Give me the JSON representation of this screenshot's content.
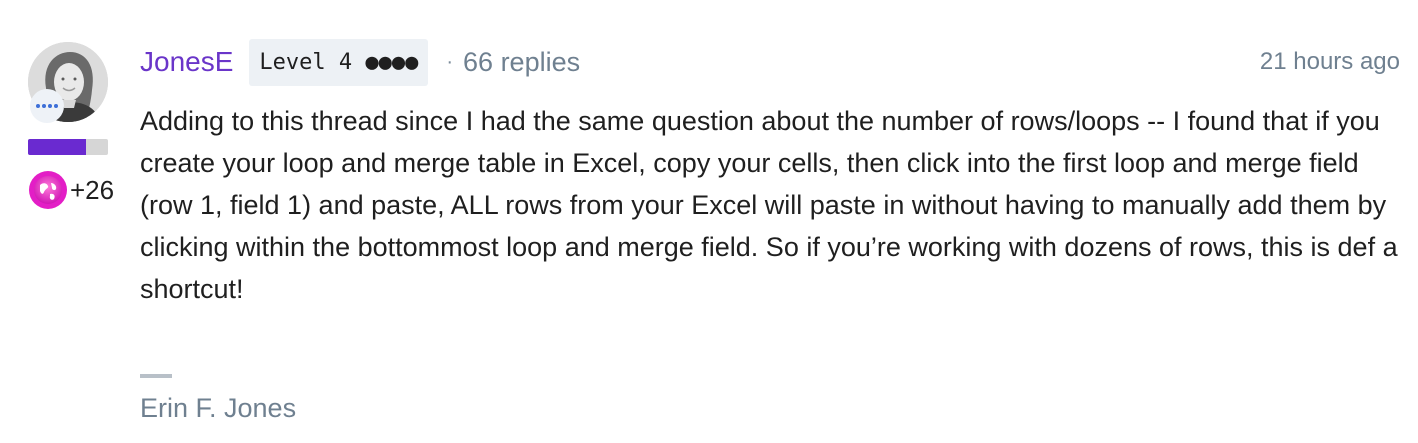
{
  "post": {
    "author": {
      "username": "JonesE",
      "level_badge": "Level 4 ●●●●",
      "replies": "66 replies",
      "kudos": "+26",
      "level_progress": 0.72,
      "avatar_icon": "user-avatar",
      "status_icon": "ellipsis-icon",
      "kudos_icon": "globe-icon"
    },
    "separator": "·",
    "timestamp": "21 hours ago",
    "body": "Adding to this thread since I had the same question about the number of rows/loops -- I found that if you create your loop and merge table in Excel, copy your cells, then click into the first loop and merge field (row 1, field 1) and paste, ALL rows from your Excel will paste in without having to manually add them by clicking within the bottommost loop and merge field. So if you’re working with dozens of rows, this is def a shortcut!",
    "signature": "Erin F. Jones"
  },
  "colors": {
    "username": "#6a35c9",
    "muted": "#6f8090",
    "badge_bg": "#edf1f5",
    "level_fill": "#6a2ad0",
    "level_track": "#d6d6d6"
  }
}
